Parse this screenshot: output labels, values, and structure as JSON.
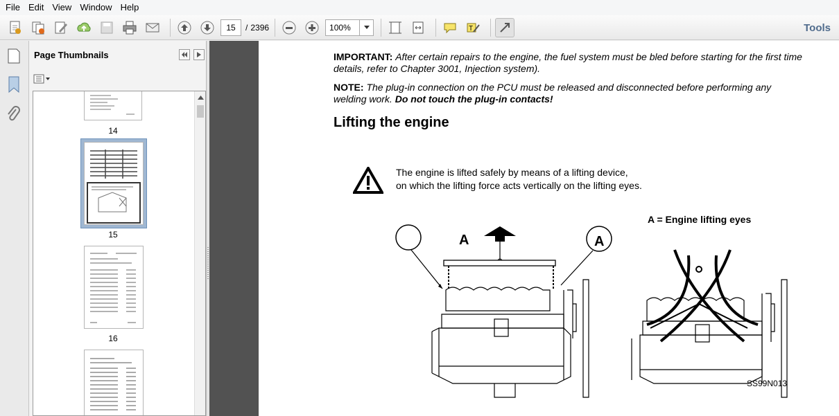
{
  "menu": [
    "File",
    "Edit",
    "View",
    "Window",
    "Help"
  ],
  "toolbar": {
    "page_current": "15",
    "page_separator": "/",
    "page_total": "2396",
    "zoom": "100%",
    "tools_label": "Tools"
  },
  "panel": {
    "title": "Page Thumbnails",
    "thumbnails": [
      {
        "label": "14"
      },
      {
        "label": "15"
      },
      {
        "label": "16"
      }
    ]
  },
  "document": {
    "important_label": "IMPORTANT:",
    "important_text": "After certain repairs to the engine, the fuel system must be bled before starting for the first time",
    "important_text2": "details, refer to Chapter 3001, Injection system).",
    "note_label": "NOTE:",
    "note_text": "The plug-in connection on the PCU must be released and disconnected before performing any",
    "note_text2a": "welding work.",
    "note_text2b": "Do not touch the plug-in contacts!",
    "heading": "Lifting the engine",
    "warning_line1": "The engine is lifted safely by means of a lifting device,",
    "warning_line2": "on which the lifting force acts vertically on the lifting eyes.",
    "legend": "A = Engine lifting eyes",
    "callout_left": "A",
    "callout_right": "A",
    "figure_code": "SS99N013"
  },
  "colors": {
    "viewer_bg": "#525252",
    "tools_color": "#4f6b8c",
    "selected_thumb": "#9fb7d2"
  }
}
